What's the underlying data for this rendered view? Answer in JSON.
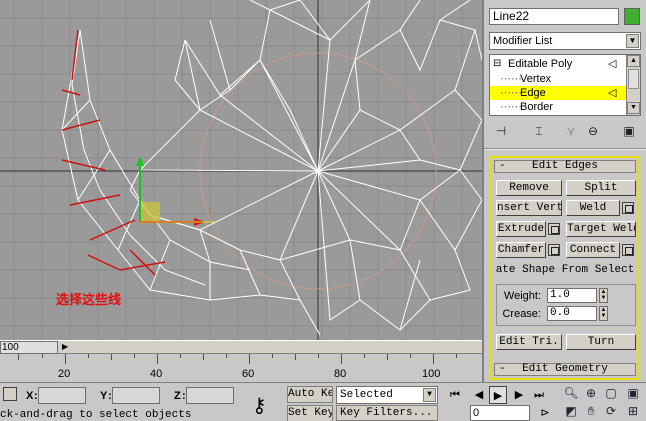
{
  "viewport": {
    "annotation": "选择这些线"
  },
  "panel": {
    "object_name": "Line22",
    "object_color": "#40b030",
    "modifier_list": "Modifier List",
    "stack": [
      {
        "label": "Editable Poly",
        "prefix": "⊟"
      },
      {
        "label": "Vertex",
        "prefix": ""
      },
      {
        "label": "Edge",
        "prefix": "",
        "selected": true
      },
      {
        "label": "Border",
        "prefix": ""
      }
    ],
    "edit_edges": {
      "sign": "-",
      "title": "Edit Edges",
      "remove": "Remove",
      "split": "Split",
      "insert_vertex": "nsert Verte",
      "weld": "Weld",
      "extrude": "Extrude",
      "target_weld": "Target Weld",
      "chamfer": "Chamfer",
      "connect": "Connect",
      "create_shape": "ate Shape From Select",
      "weight_label": "Weight:",
      "weight_value": "1.0",
      "crease_label": "Crease:",
      "crease_value": "0.0",
      "edit_tri": "Edit Tri.",
      "turn": "Turn"
    },
    "edit_geometry": {
      "sign": "-",
      "title": "Edit Geometry"
    }
  },
  "timeline": {
    "slider_text": "100",
    "ticks": [
      "20",
      "40",
      "60",
      "80",
      "100"
    ]
  },
  "status": {
    "x_label": "X",
    "y_label": "Y",
    "z_label": "Z",
    "prompt": "ck-and-drag to select objects",
    "auto_key": "Auto Key",
    "set_key": "Set Key",
    "selected": "Selected",
    "key_filters": "Key Filters...",
    "frame": "0"
  },
  "colors": {
    "edge_selected": "#d01010",
    "wire": "#ffffff",
    "highlight": "#ffff00"
  }
}
